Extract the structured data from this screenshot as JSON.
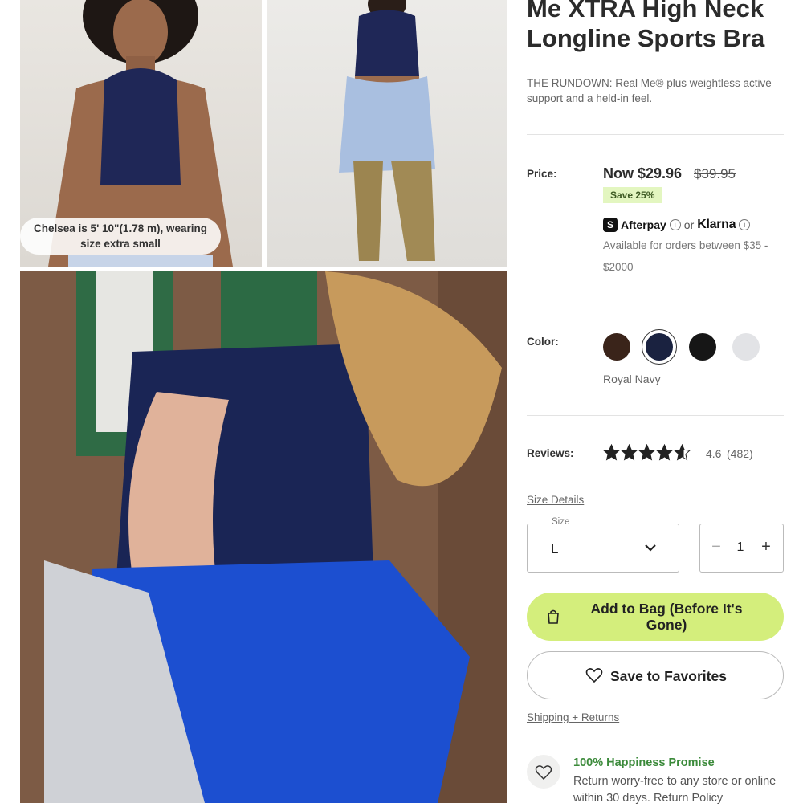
{
  "gallery": {
    "caption": "Chelsea is 5' 10\"(1.78 m), wearing size extra small"
  },
  "product": {
    "title_visible": "Me XTRA High Neck Longline Sports Bra",
    "rundown": "THE RUNDOWN: Real Me® plus weightless active support and a held-in feel."
  },
  "price": {
    "label": "Price:",
    "now": "Now $29.96",
    "was": "$39.95",
    "save": "Save 25%",
    "afterpay": "Afterpay",
    "or": "or",
    "klarna": "Klarna",
    "available": "Available for orders between $35 - $2000"
  },
  "color": {
    "label": "Color:",
    "selected": "Royal Navy",
    "swatches": [
      {
        "name": "brown-swatch",
        "hex": "#3a241a"
      },
      {
        "name": "royal-navy-swatch",
        "hex": "#1a2240"
      },
      {
        "name": "black-swatch",
        "hex": "#161616"
      },
      {
        "name": "white-swatch",
        "hex": "#e2e3e6"
      }
    ]
  },
  "reviews": {
    "label": "Reviews:",
    "rating": "4.6",
    "count": "(482)",
    "rating_value": 4.6
  },
  "size": {
    "details_link": "Size Details",
    "label": "Size",
    "value": "L"
  },
  "quantity": {
    "minus": "−",
    "value": "1",
    "plus": "+"
  },
  "actions": {
    "add_to_bag": "Add to Bag (Before It's Gone)",
    "save_favorites": "Save to Favorites",
    "shipping_link": "Shipping + Returns"
  },
  "promise": {
    "title": "100% Happiness Promise",
    "text": "Return worry-free to any store or online within 30 days. Return Policy"
  },
  "colors": {
    "accent_green": "#d4ee7c",
    "save_badge_bg": "#e3f6c0",
    "promise_green": "#3b8a3a"
  }
}
